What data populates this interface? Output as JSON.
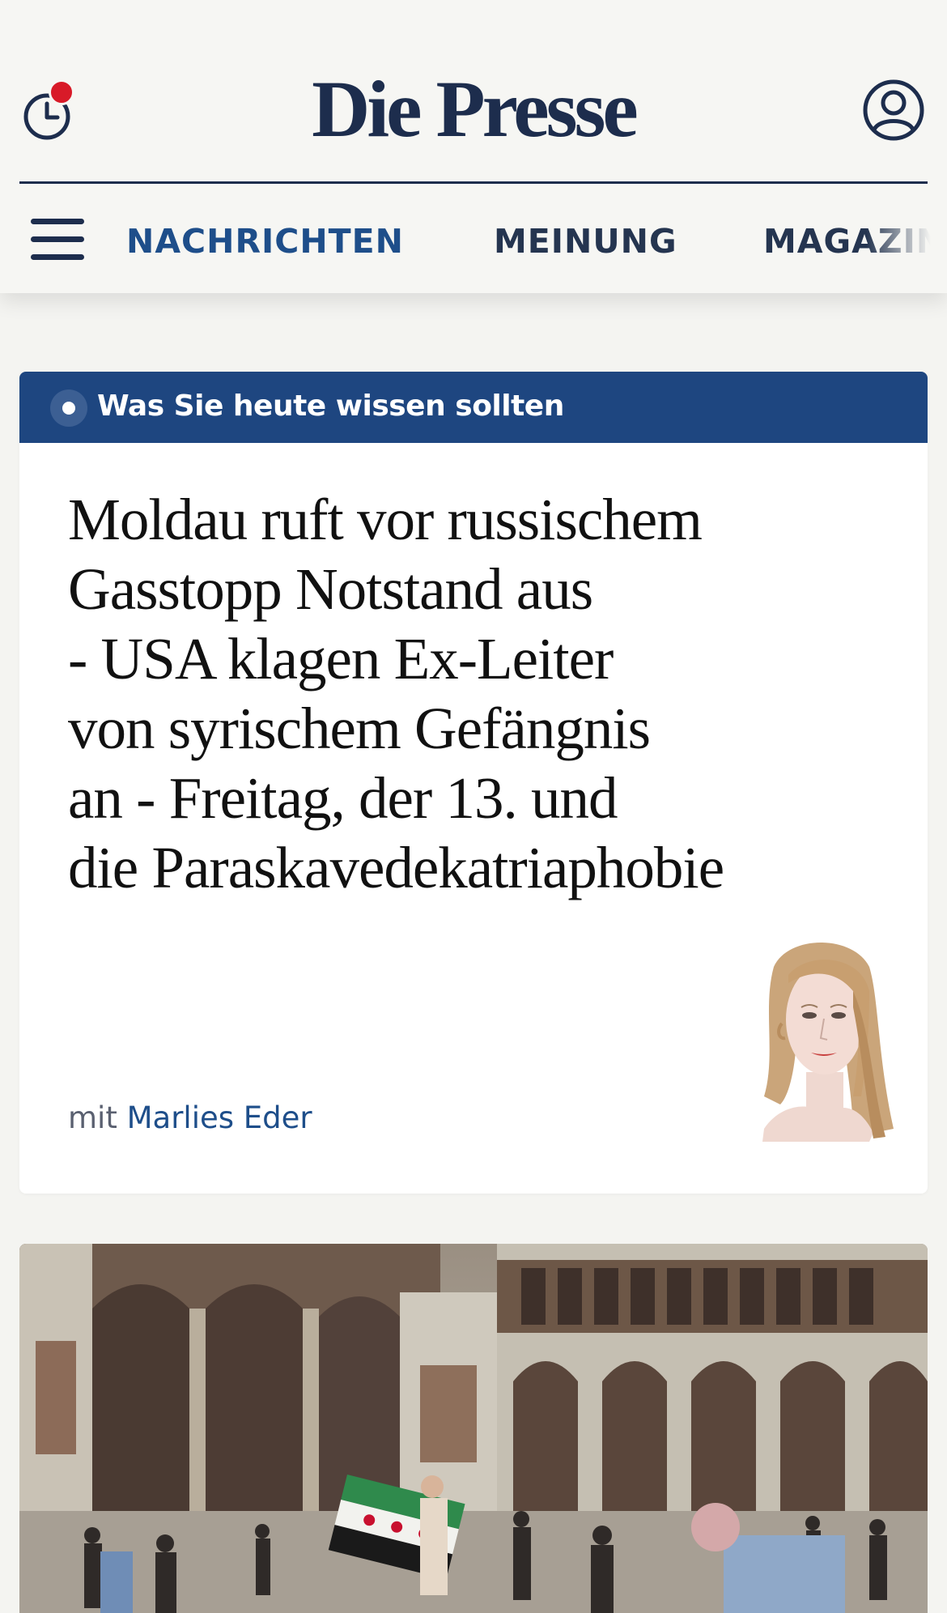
{
  "header": {
    "logo": "Die Presse",
    "nav": [
      {
        "label": "NACHRICHTEN",
        "active": true
      },
      {
        "label": "MEINUNG",
        "active": false
      },
      {
        "label": "MAGAZIN",
        "active": false
      }
    ],
    "icons": {
      "history": "history-clock-icon",
      "account": "user-account-icon",
      "menu": "hamburger-menu-icon"
    }
  },
  "briefing_card": {
    "banner": "Was Sie heute wissen sollten",
    "headline_lines": [
      "Moldau ruft vor russischem",
      "Gasstopp Notstand aus",
      "- USA klagen Ex-Leiter",
      "von syrischem Gefängnis",
      "an - Freitag, der 13. und",
      "die Paraskavedekatriaphobie"
    ],
    "byline_prefix": "mit",
    "author": "Marlies Eder"
  },
  "colors": {
    "brand_navy": "#1d2d4d",
    "accent_blue": "#1e4e8a",
    "banner_blue": "#1e4680",
    "notification_red": "#d81a28",
    "page_bg": "#f4f4f1"
  }
}
